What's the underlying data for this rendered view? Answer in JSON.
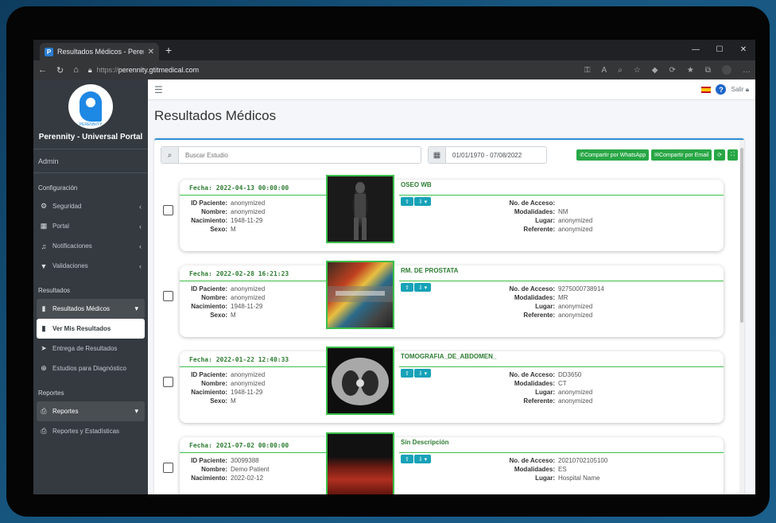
{
  "browser": {
    "tab_title": "Resultados Médicos - Perennity",
    "url_scheme": "https://",
    "url_host": "perennity.gtitmedical.com"
  },
  "sidebar": {
    "brand_name": "Perennity - Universal Portal",
    "logo_text": "PERENNITY",
    "user": "Admin",
    "section_config": "Configuración",
    "config_items": [
      {
        "label": "Seguridad",
        "icon": "users-cog-icon"
      },
      {
        "label": "Portal",
        "icon": "building-icon"
      },
      {
        "label": "Notificaciones",
        "icon": "bell-icon"
      },
      {
        "label": "Validaciones",
        "icon": "filter-icon"
      }
    ],
    "section_results": "Resultados",
    "results_items": [
      {
        "label": "Resultados Médicos",
        "icon": "clipboard-icon"
      },
      {
        "label": "Ver Mis Resultados",
        "icon": "clipboard-icon"
      },
      {
        "label": "Entrega de Resultados",
        "icon": "paper-plane-icon"
      },
      {
        "label": "Estudios para Diagnóstico",
        "icon": "search-plus-icon"
      }
    ],
    "section_reports": "Reportes",
    "reports_items": [
      {
        "label": "Reportes",
        "icon": "print-icon"
      },
      {
        "label": "Reportes y Estadísticas",
        "icon": "print-icon"
      }
    ]
  },
  "topnav": {
    "logout": "Salir"
  },
  "page": {
    "title": "Resultados Médicos",
    "search_placeholder": "Buscar Estudio",
    "date_range": "01/01/1970 - 07/08/2022",
    "share_whatsapp": "Compartir por WhatsApp",
    "share_email": "Compartir por Email"
  },
  "labels": {
    "id": "ID Paciente:",
    "name": "Nombre:",
    "birth": "Nacimiento:",
    "sex": "Sexo:",
    "access": "No. de Acceso:",
    "modality": "Modalidades:",
    "place": "Lugar:",
    "referrer": "Referente:"
  },
  "studies": [
    {
      "date": "Fecha: 2022-04-13 00:00:00",
      "title": "OSEO WB",
      "id": "anonymized",
      "name": "anonymized",
      "birth": "1948-11-29",
      "sex": "M",
      "access": "",
      "modality": "NM",
      "place": "anonymized",
      "referrer": "anonymized"
    },
    {
      "date": "Fecha: 2022-02-28 16:21:23",
      "title": "RM. DE PROSTATA",
      "id": "anonymized",
      "name": "anonymized",
      "birth": "1948-11-29",
      "sex": "M",
      "access": "9275000738914",
      "modality": "MR",
      "place": "anonymized",
      "referrer": "anonymized"
    },
    {
      "date": "Fecha: 2022-01-22 12:40:33",
      "title": "TOMOGRAFIA_DE_ABDOMEN_",
      "id": "anonymized",
      "name": "anonymized",
      "birth": "1948-11-29",
      "sex": "M",
      "access": "DD3650",
      "modality": "CT",
      "place": "anonymized",
      "referrer": "anonymized"
    },
    {
      "date": "Fecha: 2021-07-02 00:00:00",
      "title": "Sin Descripción",
      "id": "30099388",
      "name": "Demo Patient",
      "birth": "2022-02-12",
      "sex": "",
      "access": "20210702105100",
      "modality": "ES",
      "place": "Hospital Name",
      "referrer": ""
    }
  ]
}
